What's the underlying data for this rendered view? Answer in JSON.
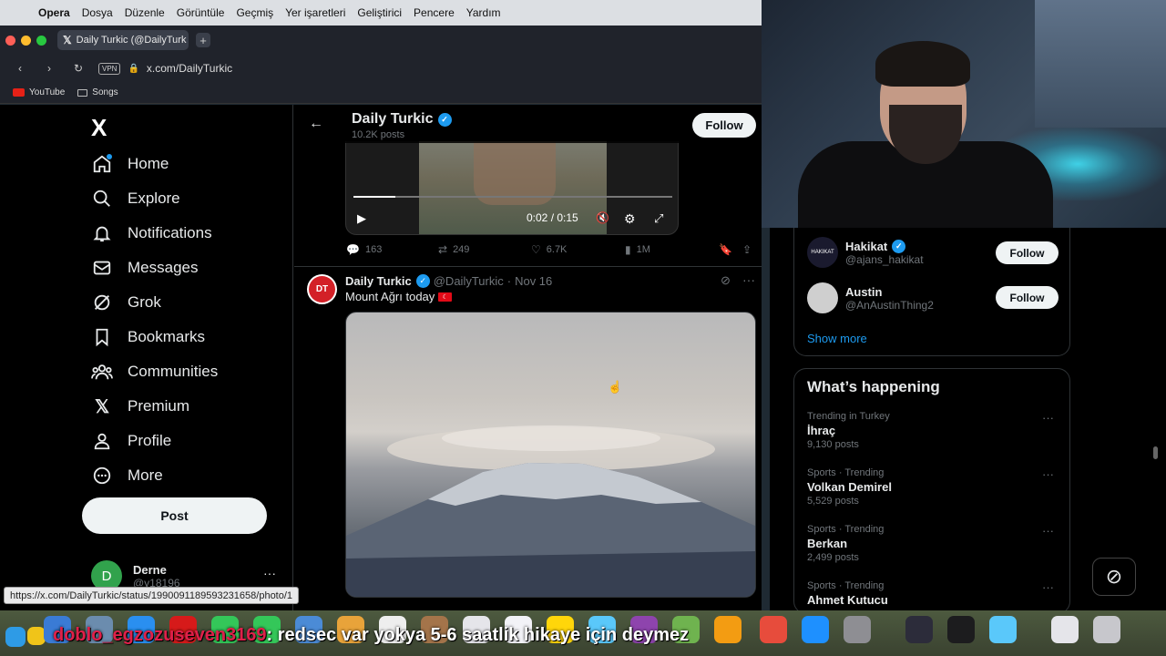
{
  "menubar": {
    "app": "Opera",
    "items": [
      "Dosya",
      "Düzenle",
      "Görüntüle",
      "Geçmiş",
      "Yer işaretleri",
      "Geliştirici",
      "Pencere",
      "Yardım"
    ]
  },
  "browser": {
    "tab_title": "Daily Turkic (@DailyTurk",
    "url": "x.com/DailyTurkic",
    "vpn": "VPN",
    "bookmarks": [
      "YouTube",
      "Songs"
    ],
    "status_url": "https://x.com/DailyTurkic/status/1990091189593231658/photo/1"
  },
  "sidebar": {
    "logo": "X",
    "items": [
      {
        "label": "Home",
        "icon": "home-icon"
      },
      {
        "label": "Explore",
        "icon": "search-icon"
      },
      {
        "label": "Notifications",
        "icon": "bell-icon"
      },
      {
        "label": "Messages",
        "icon": "mail-icon"
      },
      {
        "label": "Grok",
        "icon": "grok-icon"
      },
      {
        "label": "Bookmarks",
        "icon": "bookmark-icon"
      },
      {
        "label": "Communities",
        "icon": "communities-icon"
      },
      {
        "label": "Premium",
        "icon": "x-icon"
      },
      {
        "label": "Profile",
        "icon": "profile-icon"
      },
      {
        "label": "More",
        "icon": "more-icon"
      }
    ],
    "post_button": "Post",
    "account": {
      "initial": "D",
      "name": "Derne",
      "handle": "@y18196",
      "more": "···"
    }
  },
  "header": {
    "name": "Daily Turkic",
    "posts": "10.2K posts",
    "follow": "Follow"
  },
  "video": {
    "time": "0:02 / 0:15",
    "progress_fraction": 0.13
  },
  "actions": {
    "replies": "163",
    "reposts": "249",
    "likes": "6.7K",
    "views": "1M"
  },
  "tweet": {
    "avatar_text": "DT",
    "name": "Daily Turkic",
    "handle": "@DailyTurkic",
    "sep": "·",
    "date": "Nov 16",
    "text": "Mount Ağrı today",
    "more": "···"
  },
  "who_to_follow": [
    {
      "name": "Hakikat",
      "handle": "@ajans_hakikat",
      "avatar_text": "HAKIKAT",
      "verified": true,
      "button": "Follow"
    },
    {
      "name": "Austin",
      "handle": "@AnAustinThing2",
      "avatar_text": "",
      "verified": false,
      "button": "Follow"
    }
  ],
  "show_more": "Show more",
  "happening": {
    "title": "What’s happening",
    "trends": [
      {
        "context": "Trending in Turkey",
        "name": "İhraç",
        "count": "9,130 posts"
      },
      {
        "context": "Sports · Trending",
        "name": "Volkan Demirel",
        "count": "5,529 posts"
      },
      {
        "context": "Sports · Trending",
        "name": "Berkan",
        "count": "2,499 posts"
      },
      {
        "context": "Sports · Trending",
        "name": "Ahmet Kutucu",
        "count": ""
      }
    ]
  },
  "chat": {
    "user": "doblo_egzozuseven3169",
    "message": ": redsec var yokya 5-6 saatlik hikaye için deymez"
  },
  "colors": {
    "accent": "#1d9bf0",
    "background": "#000000",
    "border": "#2f3336"
  }
}
